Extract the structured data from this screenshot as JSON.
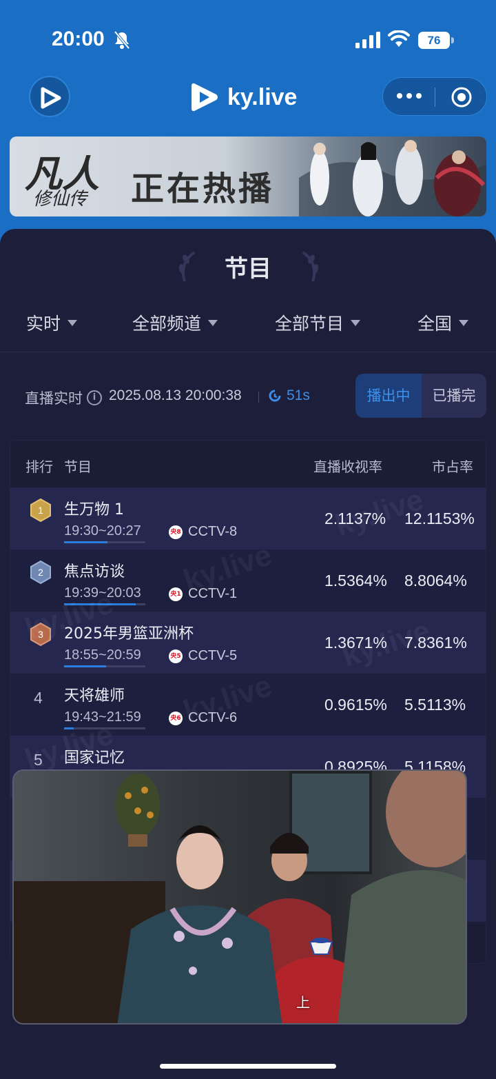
{
  "status_bar": {
    "time": "20:00",
    "battery": "76"
  },
  "nav": {
    "logo_text": "ky.live"
  },
  "banner": {
    "calligraphy": "凡人",
    "calligraphy_sub": "修仙传",
    "title": "正在热播"
  },
  "section": {
    "title": "节目"
  },
  "filters": [
    {
      "label": "实时"
    },
    {
      "label": "全部频道"
    },
    {
      "label": "全部节目"
    },
    {
      "label": "全国"
    }
  ],
  "live": {
    "label": "直播实时",
    "datetime": "2025.08.13 20:00:38",
    "refresh": "51s",
    "tab_on": "播出中",
    "tab_off": "已播完"
  },
  "table": {
    "headers": {
      "rank": "排行",
      "program": "节目",
      "rating": "直播收视率",
      "share": "市占率"
    },
    "rows": [
      {
        "rank": "1",
        "name": "生万物 1",
        "time": "19:30~20:27",
        "channel_logo": "央8",
        "channel": "CCTV-8",
        "rating": "2.1137%",
        "share": "12.1153%",
        "progress": 0.53
      },
      {
        "rank": "2",
        "name": "焦点访谈",
        "time": "19:39~20:03",
        "channel_logo": "央1",
        "channel": "CCTV-1",
        "rating": "1.5364%",
        "share": "8.8064%",
        "progress": 0.88
      },
      {
        "rank": "3",
        "name": "2025年男篮亚洲杯",
        "time": "18:55~20:59",
        "channel_logo": "央5",
        "channel": "CCTV-5",
        "rating": "1.3671%",
        "share": "7.8361%",
        "progress": 0.52
      },
      {
        "rank": "4",
        "name": "天将雄师",
        "time": "19:43~21:59",
        "channel_logo": "央6",
        "channel": "CCTV-6",
        "rating": "0.9615%",
        "share": "5.5113%",
        "progress": 0.12
      },
      {
        "rank": "5",
        "name": "国家记忆",
        "time": "",
        "channel_logo": "",
        "channel": "",
        "rating": "0.8925%",
        "share": "5.1158%",
        "progress": 0
      }
    ]
  },
  "watermark": "ky.live",
  "video": {
    "caption": "上"
  },
  "colors": {
    "header_blue": "#1a6fc4",
    "panel": "#1d1f3a",
    "accent": "#3a8ee8",
    "gold": "#c9a24a",
    "silver": "#6f87b3",
    "bronze": "#b86a4c"
  }
}
